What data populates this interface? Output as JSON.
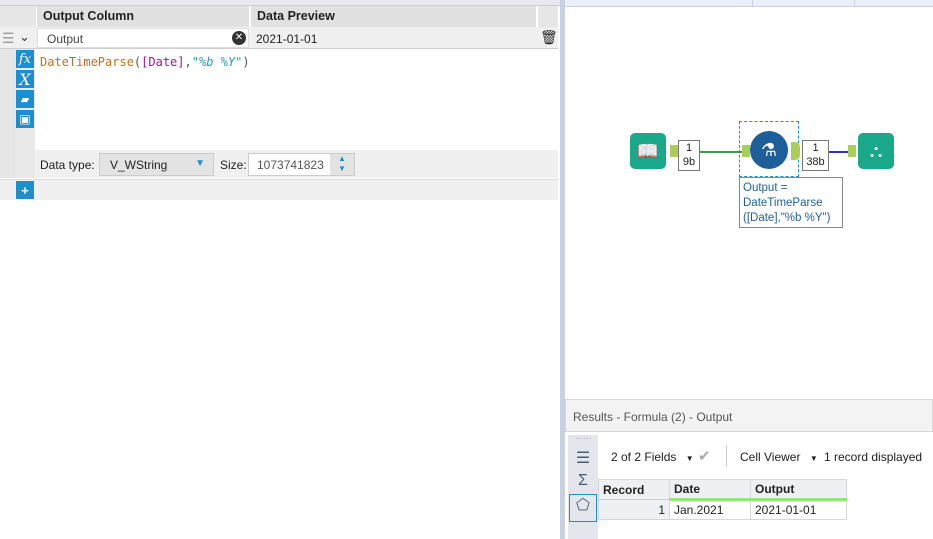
{
  "formula_editor": {
    "headers": {
      "output_column": "Output Column",
      "data_preview": "Data Preview"
    },
    "row": {
      "output_name": "Output",
      "preview": "2021-01-01",
      "expression": {
        "func": "DateTimeParse",
        "open": "(",
        "field": "[Date]",
        "comma": ",",
        "format": "\"%b %Y\"",
        "close": ")"
      },
      "data_type_label": "Data type:",
      "data_type": "V_WString",
      "size_label": "Size:",
      "size": "1073741823"
    }
  },
  "canvas": {
    "input_count": {
      "records": "1",
      "bytes": "9b"
    },
    "output_count": {
      "records": "1",
      "bytes": "38b"
    },
    "annotation": "Output = DateTimeParse ([Date],\"%b %Y\")"
  },
  "results": {
    "title": "Results - Formula (2) - Output",
    "fields_label": "2 of 2 Fields",
    "viewer_label": "Cell Viewer",
    "records_label": "1 record displayed",
    "columns": [
      "Record",
      "Date",
      "Output"
    ],
    "rows": [
      [
        "1",
        "Jan.2021",
        "2021-01-01"
      ]
    ]
  },
  "colors": {
    "accent": "#1d8fce",
    "node": "#1aa88a",
    "formula_node": "#1f5f99"
  }
}
